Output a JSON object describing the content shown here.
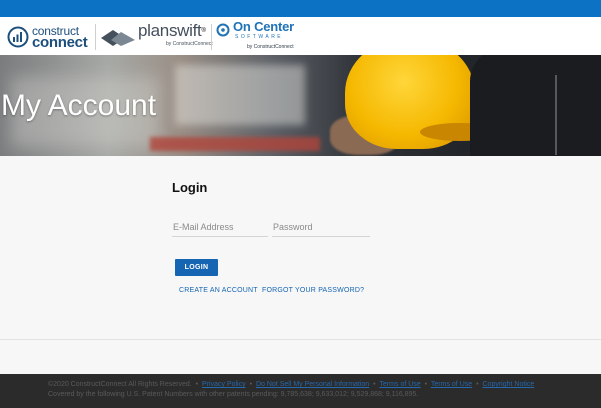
{
  "brands": {
    "constructconnect": {
      "line1": "construct",
      "line2": "connect"
    },
    "planswift": {
      "name": "planswift",
      "mark": "®",
      "byline": "by ConstructConnect"
    },
    "oncenter": {
      "name": "On Center",
      "subtitle": "SOFTWARE",
      "byline": "by ConstructConnect"
    }
  },
  "hero": {
    "title": "My Account"
  },
  "login": {
    "heading": "Login",
    "email_placeholder": "E-Mail Address",
    "password_placeholder": "Password",
    "button_label": "LOGIN",
    "create_account_label": "CREATE AN ACCOUNT",
    "forgot_password_label": "FORGOT YOUR PASSWORD?"
  },
  "footer": {
    "copyright": "©2020 ConstructConnect All Rights Reserved.",
    "links": {
      "privacy": "Privacy Policy",
      "do_not_sell": "Do Not Sell My Personal Information",
      "terms_of_use": "Terms of Use",
      "terms_of_sale": "Terms of Use",
      "copyright_notice": "Copyright Notice"
    },
    "separator": "•",
    "patents": "Covered by the following U.S. Patent Numbers with other patents pending: 9,785,638; 9,633,012; 9,529,868; 9,116,895."
  },
  "colors": {
    "top_bar": "#0b72c4",
    "primary_button": "#1565b3",
    "link": "#1565b3",
    "footer_bg": "#2b2b2b"
  },
  "icons": [
    "constructconnect-logo-icon",
    "planswift-logo-icon",
    "oncenter-logo-icon"
  ]
}
